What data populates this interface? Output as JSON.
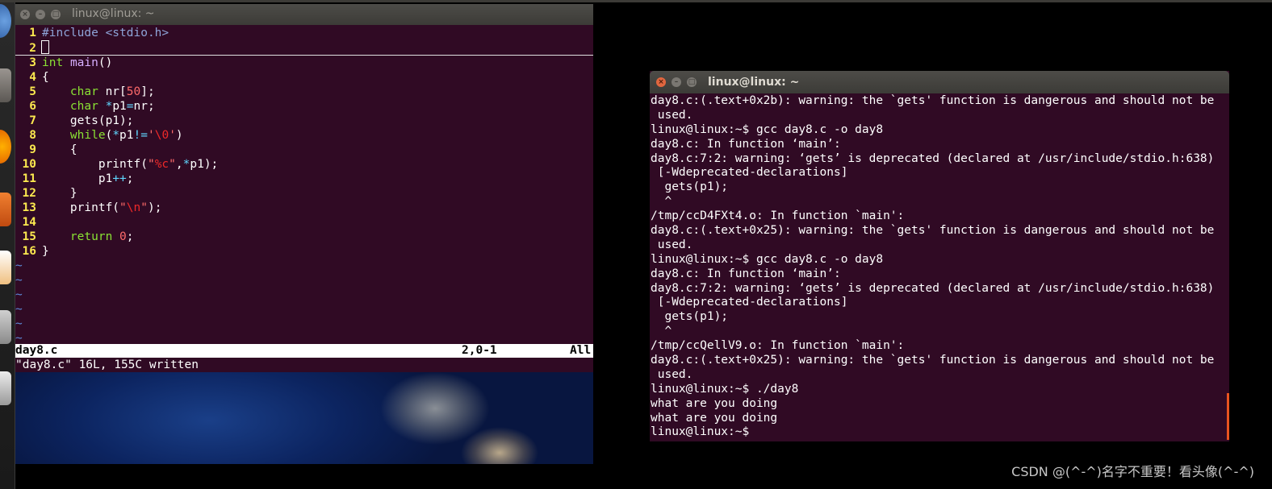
{
  "vim": {
    "title": "linux@linux: ~",
    "lines": [
      {
        "n": "1",
        "segs": [
          [
            "pre",
            "#include <stdio.h>"
          ]
        ]
      },
      {
        "n": "2",
        "segs": []
      },
      {
        "n": "3",
        "segs": [
          [
            "ty",
            "int"
          ],
          [
            "",
            " "
          ],
          [
            "fn",
            "main"
          ],
          [
            "",
            "()"
          ]
        ]
      },
      {
        "n": "4",
        "segs": [
          [
            "",
            "{"
          ]
        ]
      },
      {
        "n": "5",
        "segs": [
          [
            "",
            "    "
          ],
          [
            "ty",
            "char"
          ],
          [
            "",
            " nr["
          ],
          [
            "num",
            "50"
          ],
          [
            "",
            "];"
          ]
        ]
      },
      {
        "n": "6",
        "segs": [
          [
            "",
            "    "
          ],
          [
            "ty",
            "char"
          ],
          [
            "",
            " "
          ],
          [
            "op",
            "*"
          ],
          [
            "",
            "p1"
          ],
          [
            "op",
            "="
          ],
          [
            "",
            "nr;"
          ]
        ]
      },
      {
        "n": "7",
        "segs": [
          [
            "",
            "    gets(p1);"
          ]
        ]
      },
      {
        "n": "8",
        "segs": [
          [
            "",
            "    "
          ],
          [
            "ty",
            "while"
          ],
          [
            "",
            "("
          ],
          [
            "op",
            "*"
          ],
          [
            "",
            "p1"
          ],
          [
            "op",
            "!="
          ],
          [
            "st",
            "'"
          ],
          [
            "sp",
            "\\0"
          ],
          [
            "st",
            "'"
          ],
          [
            "",
            ")"
          ]
        ]
      },
      {
        "n": "9",
        "segs": [
          [
            "",
            "    {"
          ]
        ]
      },
      {
        "n": "10",
        "segs": [
          [
            "",
            "        printf("
          ],
          [
            "st",
            "\""
          ],
          [
            "sp",
            "%c"
          ],
          [
            "st",
            "\""
          ],
          [
            "",
            ","
          ],
          [
            "op",
            "*"
          ],
          [
            "",
            "p1);"
          ]
        ]
      },
      {
        "n": "11",
        "segs": [
          [
            "",
            "        p1"
          ],
          [
            "op",
            "++"
          ],
          [
            "",
            ";"
          ]
        ]
      },
      {
        "n": "12",
        "segs": [
          [
            "",
            "    }"
          ]
        ]
      },
      {
        "n": "13",
        "segs": [
          [
            "",
            "    printf("
          ],
          [
            "st",
            "\""
          ],
          [
            "sp",
            "\\n"
          ],
          [
            "st",
            "\""
          ],
          [
            "",
            ");"
          ]
        ]
      },
      {
        "n": "14",
        "segs": []
      },
      {
        "n": "15",
        "segs": [
          [
            "",
            "    "
          ],
          [
            "ty",
            "return"
          ],
          [
            "",
            " "
          ],
          [
            "num",
            "0"
          ],
          [
            "",
            ";"
          ]
        ]
      },
      {
        "n": "16",
        "segs": [
          [
            "",
            "}"
          ]
        ]
      }
    ],
    "tilde_count": 6,
    "tilde": "~",
    "status": {
      "file": "day8.c",
      "pos": "2,0-1",
      "scroll": "All"
    },
    "message": "\"day8.c\" 16L, 155C written"
  },
  "terminal": {
    "title": "linux@linux: ~",
    "lines": [
      "day8.c:(.text+0x2b): warning: the `gets' function is dangerous and should not be",
      " used.",
      "linux@linux:~$ gcc day8.c -o day8",
      "day8.c: In function ‘main’:",
      "day8.c:7:2: warning: ‘gets’ is deprecated (declared at /usr/include/stdio.h:638)",
      " [-Wdeprecated-declarations]",
      "  gets(p1);",
      "  ^",
      "/tmp/ccD4FXt4.o: In function `main':",
      "day8.c:(.text+0x25): warning: the `gets' function is dangerous and should not be",
      " used.",
      "linux@linux:~$ gcc day8.c -o day8",
      "day8.c: In function ‘main’:",
      "day8.c:7:2: warning: ‘gets’ is deprecated (declared at /usr/include/stdio.h:638)",
      " [-Wdeprecated-declarations]",
      "  gets(p1);",
      "  ^",
      "/tmp/ccQellV9.o: In function `main':",
      "day8.c:(.text+0x25): warning: the `gets' function is dangerous and should not be",
      " used.",
      "linux@linux:~$ ./day8",
      "what are you doing",
      "what are you doing",
      "linux@linux:~$ "
    ]
  },
  "window_buttons": {
    "close": "×",
    "min": "–",
    "max": "□"
  },
  "watermark": "CSDN @(^-^)名字不重要！看头像(^-^)",
  "colors": {
    "terminal_bg": "#300a24",
    "titlebar": "#3c3b37",
    "close_button": "#e1663f",
    "line_number": "#fce94f"
  }
}
